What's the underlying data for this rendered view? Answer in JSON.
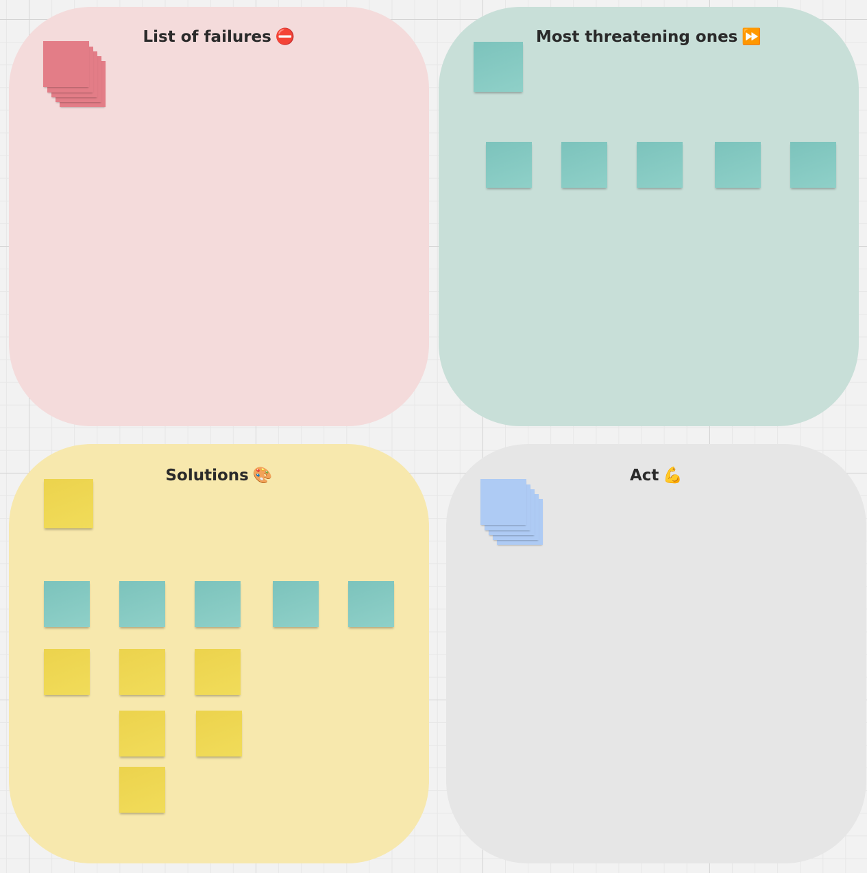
{
  "board": {
    "frames": [
      {
        "id": "failures",
        "title": "List of failures",
        "emoji": "⛔",
        "background": "#f4dbdb"
      },
      {
        "id": "threatening",
        "title": "Most threatening ones",
        "emoji": "⏩",
        "background": "#c8dfd8"
      },
      {
        "id": "solutions",
        "title": "Solutions",
        "emoji": "🎨",
        "background": "#f7e8ad"
      },
      {
        "id": "act",
        "title": "Act",
        "emoji": "💪",
        "background": "#e6e6e6"
      }
    ]
  },
  "sticky_colors": {
    "teal": "#87cbc3",
    "yellow": "#eed550",
    "pink": "#e37d87",
    "blue": "#aecbf4"
  }
}
